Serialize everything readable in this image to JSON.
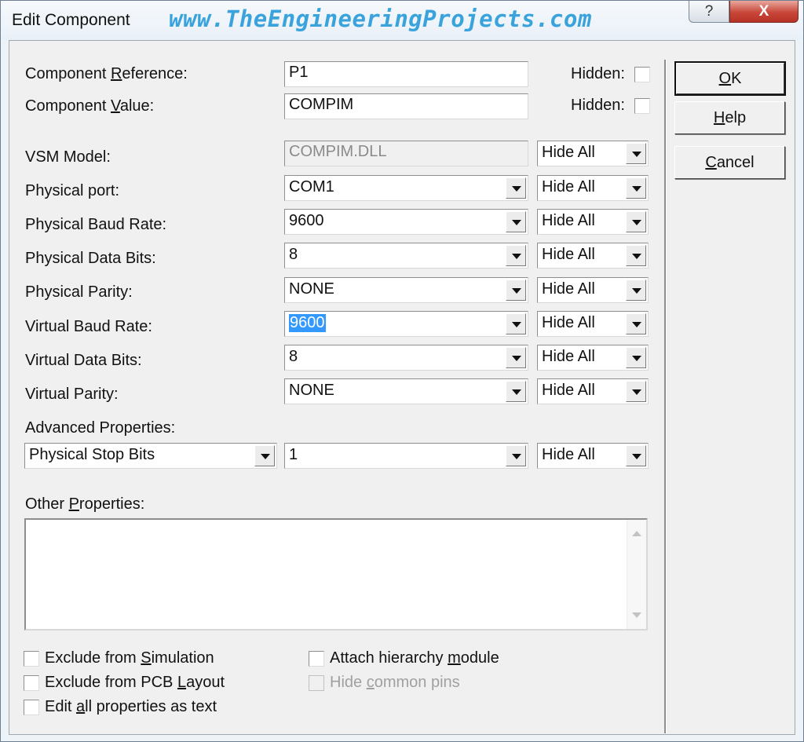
{
  "window": {
    "title": "Edit Component",
    "watermark": "www.TheEngineeringProjects.com",
    "help_glyph": "?",
    "close_glyph": "X"
  },
  "fields": {
    "reference": {
      "label_pre": "Component ",
      "label_u": "R",
      "label_post": "eference:",
      "value": "P1",
      "hidden_label": "Hidden:"
    },
    "value": {
      "label_pre": "Component ",
      "label_u": "V",
      "label_post": "alue:",
      "value": "COMPIM",
      "hidden_label": "Hidden:"
    }
  },
  "properties": [
    {
      "label": "VSM Model:",
      "value": "COMPIM.DLL",
      "visibility": "Hide All",
      "editable": false
    },
    {
      "label": "Physical port:",
      "value": "COM1",
      "visibility": "Hide All",
      "editable": true
    },
    {
      "label": "Physical Baud Rate:",
      "value": "9600",
      "visibility": "Hide All",
      "editable": true
    },
    {
      "label": "Physical Data Bits:",
      "value": "8",
      "visibility": "Hide All",
      "editable": true
    },
    {
      "label": "Physical Parity:",
      "value": "NONE",
      "visibility": "Hide All",
      "editable": true
    },
    {
      "label": "Virtual Baud Rate:",
      "value": "9600",
      "visibility": "Hide All",
      "editable": true,
      "selected": true
    },
    {
      "label": "Virtual Data Bits:",
      "value": "8",
      "visibility": "Hide All",
      "editable": true
    },
    {
      "label": "Virtual Parity:",
      "value": "NONE",
      "visibility": "Hide All",
      "editable": true
    }
  ],
  "advanced": {
    "label": "Advanced Properties:",
    "property": "Physical Stop Bits",
    "value": "1",
    "visibility": "Hide All"
  },
  "other": {
    "label_pre": "Other ",
    "label_u": "P",
    "label_post": "roperties:",
    "text": ""
  },
  "checkboxes": {
    "exclude_sim": {
      "pre": "Exclude from ",
      "u": "S",
      "post": "imulation",
      "checked": false
    },
    "exclude_pcb": {
      "pre": "Exclude from PCB ",
      "u": "L",
      "post": "ayout",
      "checked": false
    },
    "edit_text": {
      "pre": "Edit ",
      "u": "a",
      "post": "ll properties as text",
      "checked": false
    },
    "attach": {
      "pre": "Attach hierarchy ",
      "u": "m",
      "post": "odule",
      "checked": false
    },
    "hide_pins": {
      "pre": "Hide ",
      "u": "c",
      "post": "ommon pins",
      "checked": false,
      "disabled": true
    }
  },
  "buttons": {
    "ok": {
      "u": "O",
      "post": "K"
    },
    "help": {
      "u": "H",
      "post": "elp"
    },
    "cancel": {
      "u": "C",
      "post": "ancel"
    }
  }
}
